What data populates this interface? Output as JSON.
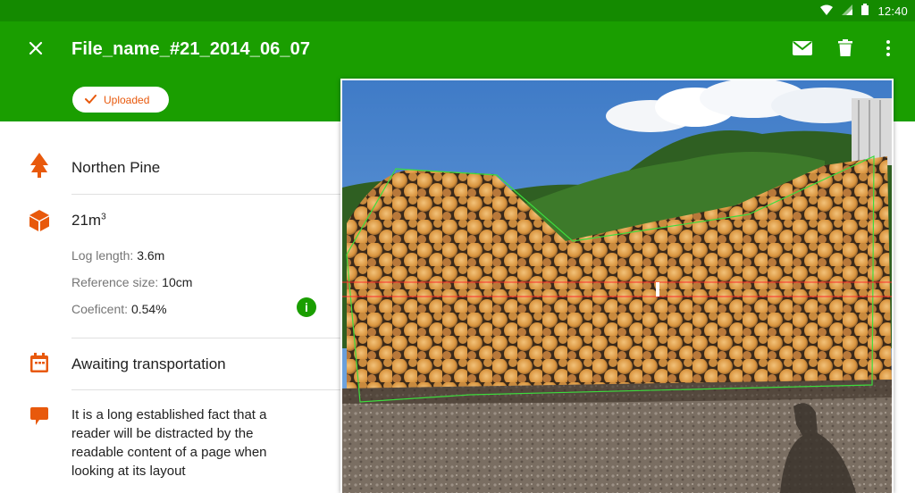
{
  "status_bar": {
    "time": "12:40"
  },
  "app_bar": {
    "title": "File_name_#21_2014_06_07"
  },
  "status_chip": {
    "label": "Uploaded"
  },
  "species": {
    "label": "Northen Pine"
  },
  "volume": {
    "value": "21m",
    "unit_sup": "3",
    "log_length_label": "Log length:",
    "log_length_value": "3.6m",
    "reference_size_label": "Reference size:",
    "reference_size_value": "10cm",
    "coefficient_label": "Coeficent:",
    "coefficient_value": "0.54%"
  },
  "transport": {
    "label": "Awaiting transportation"
  },
  "comment": {
    "text": "It is a long established fact that a reader will be distracted by the readable content of a page when looking at its layout"
  },
  "colors": {
    "primary": "#1a9e00",
    "status_bar": "#148a00",
    "accent": "#e8590c"
  }
}
